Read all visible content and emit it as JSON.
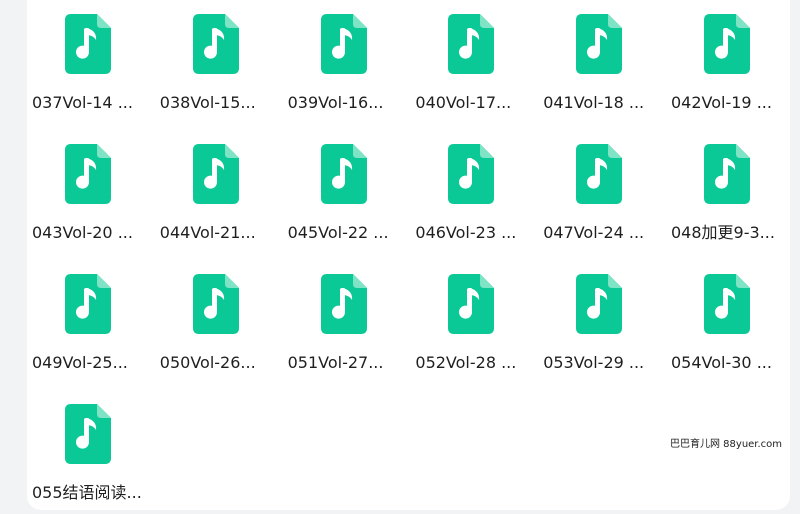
{
  "colors": {
    "icon_green": "#0bc996",
    "icon_fold": "#7fe3c5",
    "note_white": "#ffffff",
    "text": "#1f1f1f"
  },
  "file_icon": "music-file-icon",
  "files": [
    {
      "name": "037Vol-14 ..."
    },
    {
      "name": "038Vol-15..."
    },
    {
      "name": "039Vol-16..."
    },
    {
      "name": "040Vol-17..."
    },
    {
      "name": "041Vol-18 ..."
    },
    {
      "name": "042Vol-19 ..."
    },
    {
      "name": "043Vol-20 ..."
    },
    {
      "name": "044Vol-21..."
    },
    {
      "name": "045Vol-22 ..."
    },
    {
      "name": "046Vol-23 ..."
    },
    {
      "name": "047Vol-24 ..."
    },
    {
      "name": "048加更9-3..."
    },
    {
      "name": "049Vol-25..."
    },
    {
      "name": "050Vol-26..."
    },
    {
      "name": "051Vol-27..."
    },
    {
      "name": "052Vol-28 ..."
    },
    {
      "name": "053Vol-29 ..."
    },
    {
      "name": "054Vol-30 ..."
    },
    {
      "name": "055结语阅读..."
    }
  ],
  "watermark": "巴巴育儿网 88yuer.com"
}
